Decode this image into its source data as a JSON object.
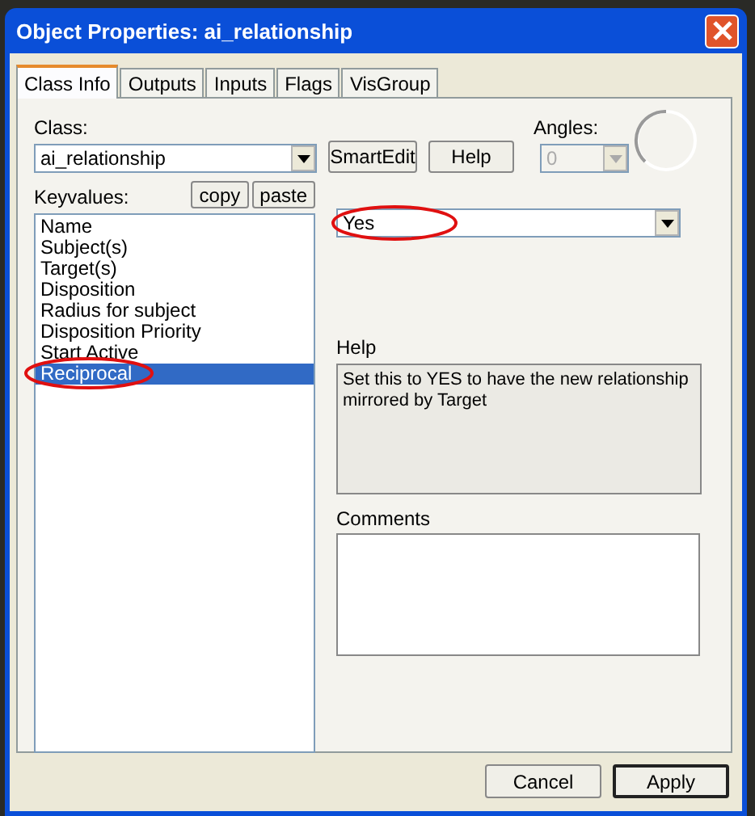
{
  "window": {
    "title": "Object Properties: ai_relationship"
  },
  "tabs": [
    {
      "label": "Class Info",
      "selected": true
    },
    {
      "label": "Outputs",
      "selected": false
    },
    {
      "label": "Inputs",
      "selected": false
    },
    {
      "label": "Flags",
      "selected": false
    },
    {
      "label": "VisGroup",
      "selected": false
    }
  ],
  "class": {
    "label": "Class:",
    "value": "ai_relationship"
  },
  "smartedit_button": "SmartEdit",
  "help_button": "Help",
  "angles": {
    "label": "Angles:",
    "value": "0",
    "disabled": true
  },
  "keyvalues": {
    "label": "Keyvalues:",
    "copy": "copy",
    "paste": "paste",
    "items": [
      {
        "label": "Name",
        "selected": false,
        "circled": false
      },
      {
        "label": "Subject(s)",
        "selected": false,
        "circled": false
      },
      {
        "label": "Target(s)",
        "selected": false,
        "circled": false
      },
      {
        "label": "Disposition",
        "selected": false,
        "circled": false
      },
      {
        "label": "Radius for subject",
        "selected": false,
        "circled": false
      },
      {
        "label": "Disposition Priority",
        "selected": false,
        "circled": false
      },
      {
        "label": "Start Active",
        "selected": false,
        "circled": false
      },
      {
        "label": "Reciprocal",
        "selected": true,
        "circled": true
      }
    ]
  },
  "value": {
    "value": "Yes",
    "circled": true
  },
  "help": {
    "label": "Help",
    "text": "Set this to YES to have the new relationship mirrored by Target"
  },
  "comments": {
    "label": "Comments"
  },
  "buttons": [
    "Cancel",
    "Apply"
  ]
}
